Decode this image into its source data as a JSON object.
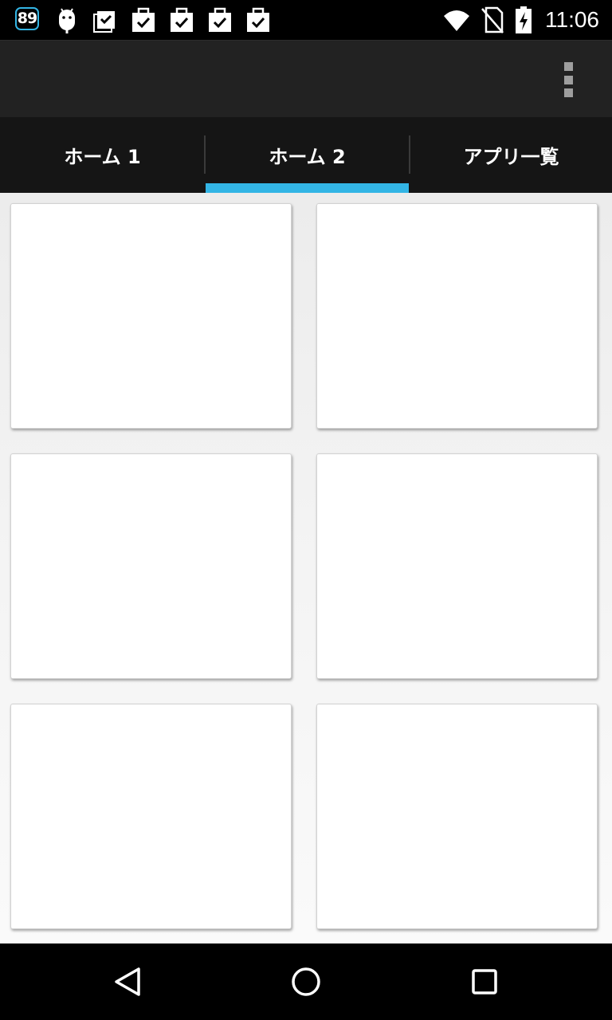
{
  "status_bar": {
    "notification_count": "89",
    "time": "11:06",
    "icons": [
      "android-icon",
      "clipboard-check-icon",
      "bag-check-icon",
      "bag-check-icon",
      "bag-check-icon",
      "bag-check-icon",
      "wifi-icon",
      "no-sim-icon",
      "battery-charging-icon"
    ]
  },
  "action_bar": {
    "overflow_icon": "overflow-menu-icon"
  },
  "tabs": [
    {
      "label": "ホーム 1",
      "selected": false
    },
    {
      "label": "ホーム 2",
      "selected": true
    },
    {
      "label": "アプリ一覧",
      "selected": false
    }
  ],
  "accent_color": "#33b5e5",
  "cards": [
    {},
    {},
    {},
    {},
    {},
    {}
  ],
  "nav_bar": {
    "back_icon": "back-triangle-icon",
    "home_icon": "home-circle-icon",
    "recents_icon": "recents-square-icon"
  }
}
